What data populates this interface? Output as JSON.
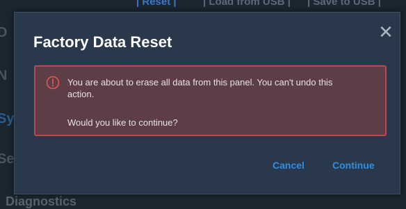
{
  "background": {
    "top_links": [
      "| Reset |",
      "| Load from USB |",
      "| Save to USB |"
    ],
    "side_letters": [
      "D",
      "N",
      "Sy",
      "Se"
    ],
    "bottom_label": "Diagnostics"
  },
  "dialog": {
    "title": "Factory Data Reset",
    "close_icon": "close-icon",
    "alert": {
      "icon": "alert-circle-icon",
      "message": "You are about to erase all data from this panel. You can't undo this action.",
      "question": "Would you like to continue?",
      "colors": {
        "background": "#5d3e47",
        "border": "#c2464a",
        "icon": "#e05a4d"
      }
    },
    "buttons": {
      "cancel": "Cancel",
      "continue": "Continue"
    },
    "accent_color": "#2f8fe0"
  }
}
